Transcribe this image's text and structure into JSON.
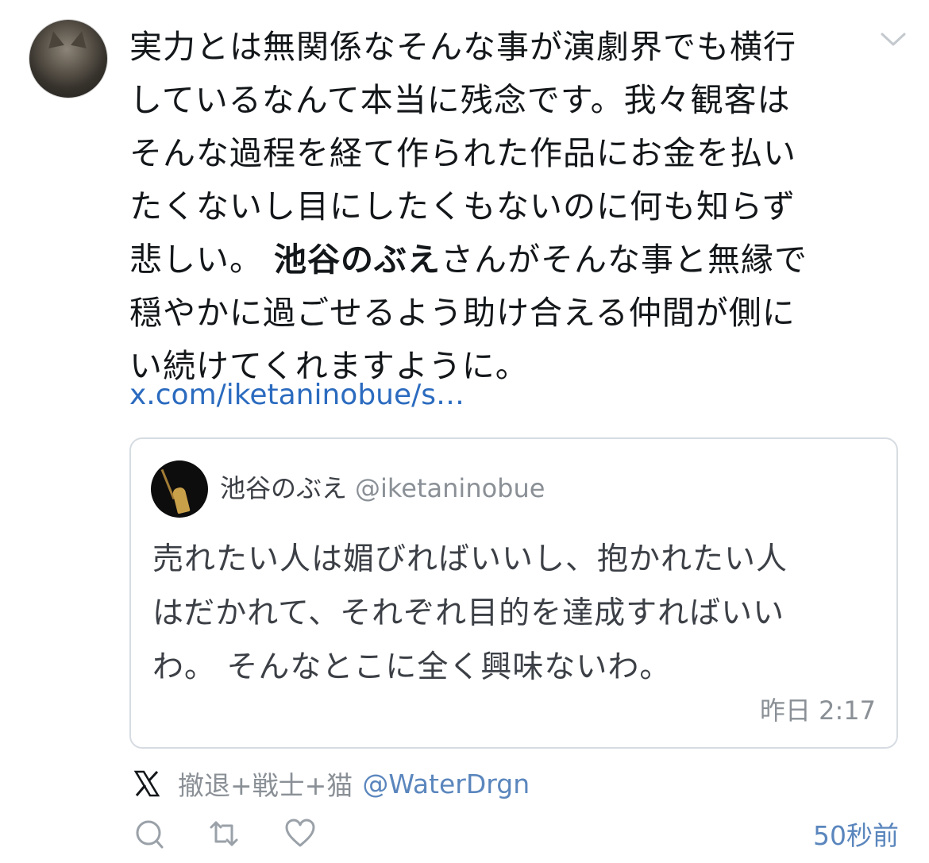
{
  "tweet": {
    "text_before": "実力とは無関係なそんな事が演劇界でも横行\nしているなんて本当に残念です。我々観客は\nそんな過程を経て作られた作品にお金を払い\nたくないし目にしたくもないのに何も知らず\n悲しい。 ",
    "mention": "池谷のぶえ",
    "text_after": "さんがそんな事と無縁で\n穏やかに過ごせるよう助け合える仲間が側に\nい続けてくれますように。",
    "link": "x.com/iketaninobue/s…"
  },
  "quote": {
    "name": "池谷のぶえ",
    "handle": "@iketaninobue",
    "text": "売れたい人は媚びればいいし、抱かれたい人\nはだかれて、それぞれ目的を達成すればいい\nわ。 そんなとこに全く興味ないわ。",
    "time": "昨日 2:17"
  },
  "source": {
    "user": "撤退+戦士+猫",
    "handle": "@WaterDrgn"
  },
  "actions": {
    "time_ago": "50秒前"
  },
  "colors": {
    "link": "#2b6bbf",
    "muted": "#8a9096",
    "accent": "#5a86bd",
    "border": "#d6dce2"
  },
  "icons": [
    "cat-avatar",
    "chevron-down-icon",
    "quoted-avatar",
    "x-logo-icon",
    "reply-icon",
    "retweet-icon",
    "like-icon"
  ]
}
